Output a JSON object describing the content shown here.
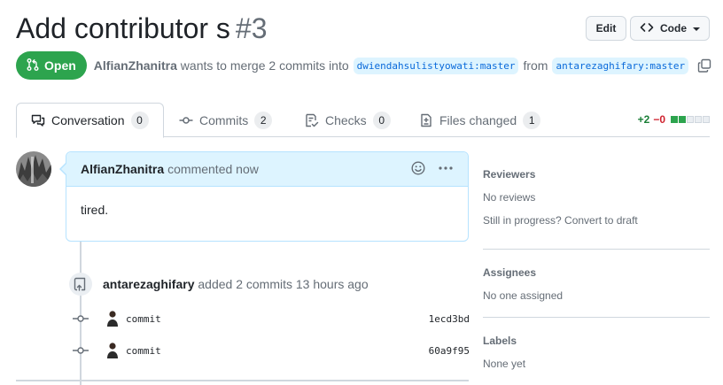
{
  "header": {
    "title": "Add contributor s",
    "number": "#3",
    "edit_label": "Edit",
    "code_label": "Code"
  },
  "meta": {
    "state": "Open",
    "author": "AlfianZhanitra",
    "merge_text": "wants to merge 2 commits into",
    "base_branch": "dwiendahsulistyowati:master",
    "from_text": "from",
    "head_branch": "antarezaghifary:master"
  },
  "tabs": [
    {
      "label": "Conversation",
      "count": "0"
    },
    {
      "label": "Commits",
      "count": "2"
    },
    {
      "label": "Checks",
      "count": "0"
    },
    {
      "label": "Files changed",
      "count": "1"
    }
  ],
  "diffstat": {
    "additions": "+2",
    "deletions": "−0",
    "additions_blocks": 2,
    "total_blocks": 5
  },
  "comment": {
    "author": "AlfianZhanitra",
    "action": "commented now",
    "body": "tired."
  },
  "event": {
    "actor": "antarezaghifary",
    "text": "added 2 commits 13 hours ago"
  },
  "commits": [
    {
      "message": "commit",
      "sha": "1ecd3bd"
    },
    {
      "message": "commit",
      "sha": "60a9f95"
    }
  ],
  "sidebar": {
    "reviewers": {
      "title": "Reviewers",
      "line1": "No reviews",
      "line2": "Still in progress? Convert to draft"
    },
    "assignees": {
      "title": "Assignees",
      "value": "No one assigned"
    },
    "labels": {
      "title": "Labels",
      "value": "None yet"
    }
  },
  "colors": {
    "open_green": "#2da44e",
    "link_blue": "#0969da",
    "branch_bg": "#ddf4ff",
    "comment_header_bg": "#ddf4ff"
  },
  "icons": [
    "git-pull-request-icon",
    "copy-icon",
    "code-icon",
    "comment-discussion-icon",
    "git-commit-icon",
    "checklist-icon",
    "file-diff-icon",
    "smiley-icon",
    "kebab-horizontal-icon",
    "repo-push-icon"
  ]
}
